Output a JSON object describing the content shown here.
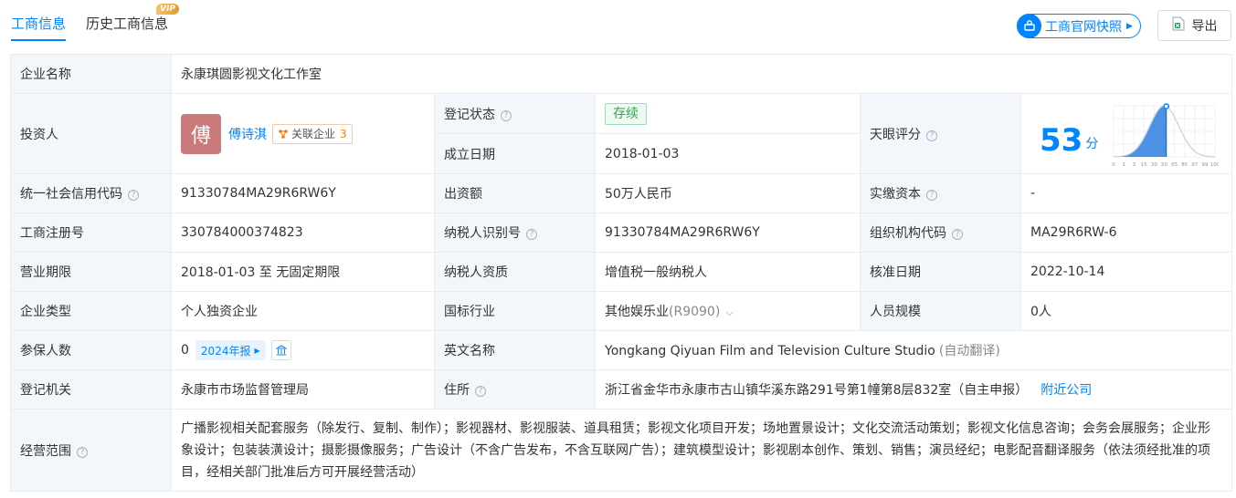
{
  "tabs": [
    {
      "label": "工商信息"
    },
    {
      "label": "历史工商信息",
      "badge": "VIP"
    }
  ],
  "header": {
    "snapshot_label": "工商官网快照",
    "export_label": "导出"
  },
  "company": {
    "name_label": "企业名称",
    "name": "永康琪圆影视文化工作室",
    "investor_label": "投资人",
    "investor_avatar": "傅",
    "investor_name": "傅诗淇",
    "related_label": "关联企业",
    "related_count": "3",
    "status_label": "登记状态",
    "status": "存续",
    "found_label": "成立日期",
    "found_date": "2018-01-03",
    "score_label": "天眼评分",
    "score": "53",
    "score_unit": "分",
    "credit_label": "统一社会信用代码",
    "credit_code": "91330784MA29R6RW6Y",
    "capital_label": "出资额",
    "capital": "50万人民币",
    "paid_label": "实缴资本",
    "paid": "-",
    "regno_label": "工商注册号",
    "regno": "330784000374823",
    "taxid_label": "纳税人识别号",
    "taxid": "91330784MA29R6RW6Y",
    "org_label": "组织机构代码",
    "org_code": "MA29R6RW-6",
    "term_label": "营业期限",
    "term": "2018-01-03 至 无固定期限",
    "taxq_label": "纳税人资质",
    "taxq": "增值税一般纳税人",
    "approve_label": "核准日期",
    "approve_date": "2022-10-14",
    "type_label": "企业类型",
    "type": "个人独资企业",
    "industry_label": "国标行业",
    "industry": "其他娱乐业",
    "industry_code": "(R9090)",
    "staff_label": "人员规模",
    "staff": "0人",
    "insured_label": "参保人数",
    "insured": "0",
    "report_year": "2024年报",
    "en_label": "英文名称",
    "en_name": "Yongkang Qiyuan Film and Television Culture Studio",
    "en_note": "(自动翻译)",
    "authority_label": "登记机关",
    "authority": "永康市市场监督管理局",
    "address_label": "住所",
    "address": "浙江省金华市永康市古山镇华溪东路291号第1幢第8层832室（自主申报）",
    "nearby_label": "附近公司",
    "scope_label": "经营范围",
    "scope": "广播影视相关配套服务（除发行、复制、制作）；影视器材、影视服装、道具租赁；影视文化项目开发；场地置景设计；文化交流活动策划；影视文化信息咨询；会务会展服务；企业形象设计；包装装潢设计；摄影摄像服务；广告设计（不含广告发布，不含互联网广告）；建筑模型设计；影视剧本创作、策划、销售；演员经纪；电影配音翻译服务（依法须经批准的项目，经相关部门批准后方可开展经营活动）"
  },
  "chart_data": {
    "type": "area",
    "x": [
      0,
      1,
      3,
      15,
      30,
      50,
      65,
      85,
      97,
      99,
      100
    ],
    "marker": 53,
    "ylim": [
      0,
      1
    ]
  },
  "colors": {
    "accent": "#0084ff",
    "label_bg": "#f3f6fa",
    "status_green": "#2fa84f",
    "avatar": "#c97b7b"
  }
}
